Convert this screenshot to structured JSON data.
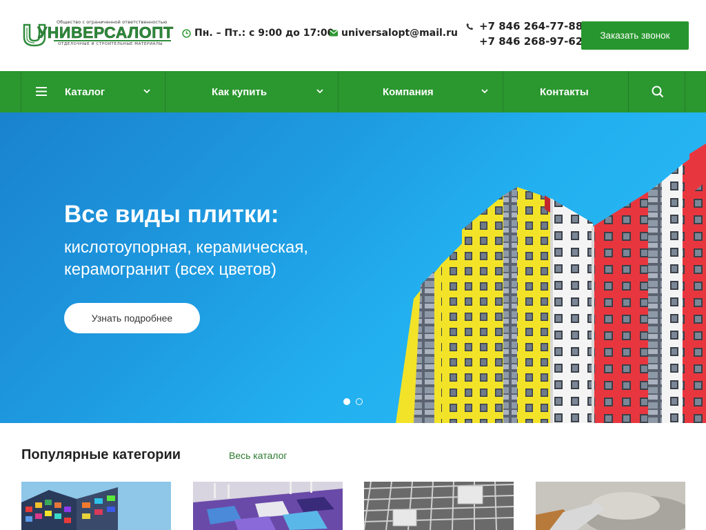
{
  "header": {
    "logo": {
      "top_text": "Общество с ограниченной ответственностью",
      "name_part1": "УНИВЕРСАЛ",
      "name_part2": "ОПТ",
      "sub_text": "ОТДЕЛОЧНЫЕ И СТРОИТЕЛЬНЫЕ МАТЕРИАЛЫ"
    },
    "hours": "Пн. – Пт.: с 9:00 до 17:00",
    "hours_icon": "clock-icon",
    "email": "universalopt@mail.ru",
    "email_icon": "envelope-icon",
    "phone_icon": "phone-icon",
    "phones": [
      "+7 846 264-77-88",
      "+7 846 268-97-62"
    ],
    "callback_label": "Заказать звонок"
  },
  "nav": {
    "items": [
      {
        "label": "Каталог",
        "icon": "menu-icon",
        "dropdown": true
      },
      {
        "label": "Как купить",
        "dropdown": true
      },
      {
        "label": "Компания",
        "dropdown": true
      },
      {
        "label": "Контакты",
        "dropdown": false
      }
    ],
    "search_icon": "search-icon"
  },
  "hero": {
    "title": "Все виды плитки:",
    "subtitle_line1": "кислотоупорная, керамическая,",
    "subtitle_line2": "керамогранит (всех цветов)",
    "button_label": "Узнать подробнее",
    "slides_count": 2,
    "active_slide": 1
  },
  "popular": {
    "title": "Популярные категории",
    "all_link": "Весь каталог"
  },
  "colors": {
    "brand_green": "#2b972f",
    "hero_blue": "#1e9ae0"
  }
}
